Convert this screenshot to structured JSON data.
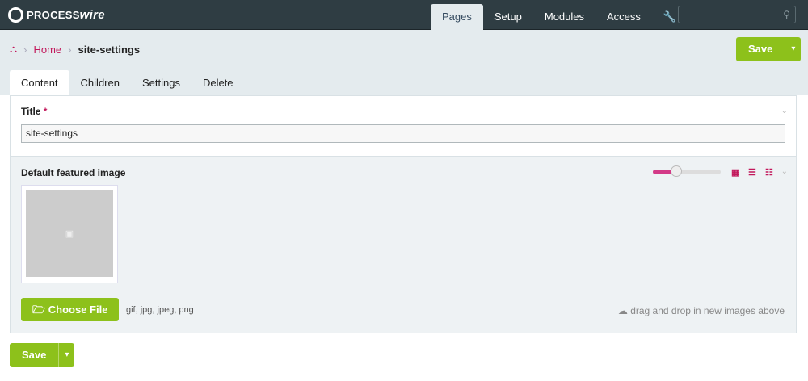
{
  "header": {
    "logo": "PROCESSwire",
    "nav": [
      {
        "label": "Pages",
        "active": true
      },
      {
        "label": "Setup"
      },
      {
        "label": "Modules"
      },
      {
        "label": "Access"
      }
    ],
    "tools_icon": "wrench-icon",
    "search_icon": "search-icon"
  },
  "breadcrumb": {
    "home": "Home",
    "current": "site-settings"
  },
  "save": {
    "label": "Save",
    "dropdown": "▾"
  },
  "tabs": [
    {
      "label": "Content",
      "active": true
    },
    {
      "label": "Children"
    },
    {
      "label": "Settings"
    },
    {
      "label": "Delete"
    }
  ],
  "title_field": {
    "label": "Title",
    "required": "*",
    "value": "site-settings"
  },
  "image_field": {
    "label": "Default featured image",
    "size_slider_percent": 35,
    "choose_label": "Choose File",
    "extensions": "gif, jpg, jpeg, png",
    "drop_hint": "drag and drop in new images above"
  },
  "colors": {
    "accent": "#c2185b",
    "button": "#8dc11b",
    "header": "#2f3d43"
  }
}
